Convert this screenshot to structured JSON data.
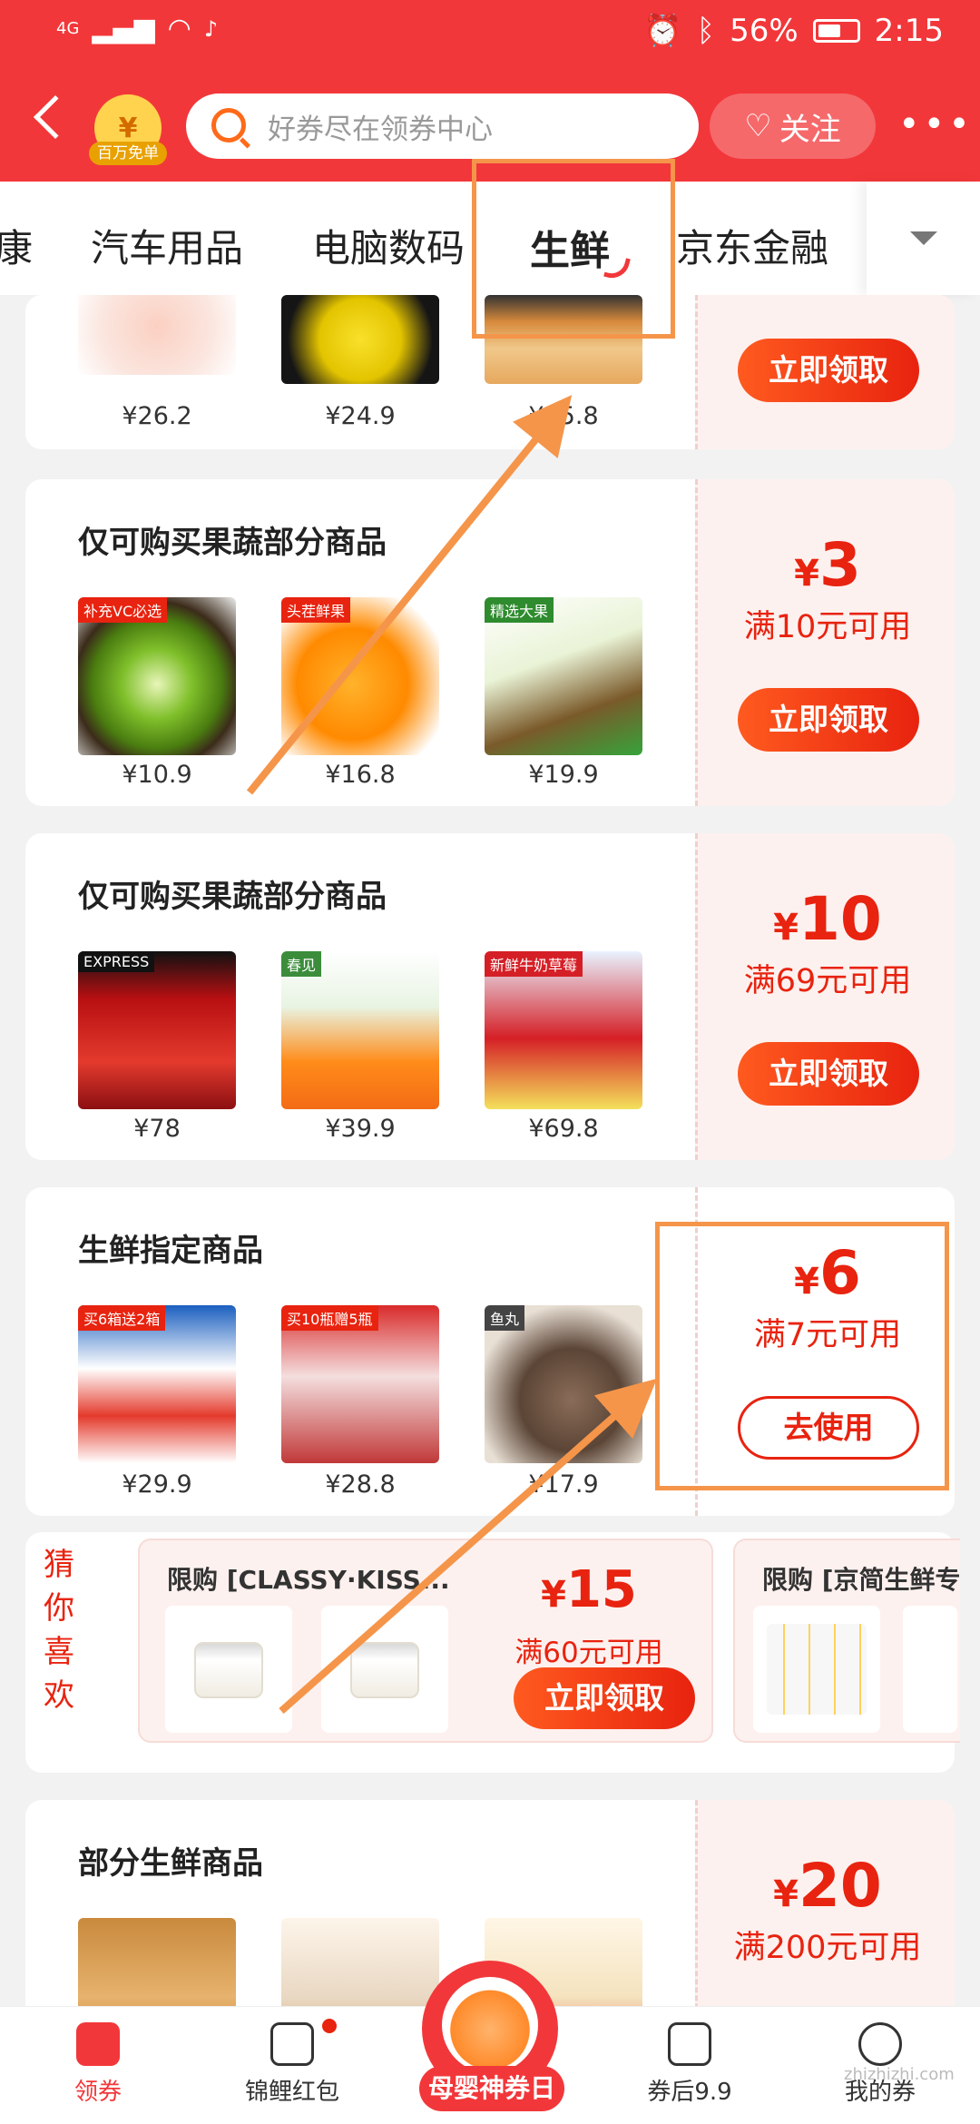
{
  "status_bar": {
    "network": "4G",
    "signal": "ıll",
    "battery": "56%",
    "time": "2:15"
  },
  "header": {
    "badge_symbol": "¥",
    "badge_label": "百万免单",
    "search_placeholder": "好券尽在领券中心",
    "follow_label": "关注",
    "more_label": "•••"
  },
  "tabs": [
    {
      "label": "康"
    },
    {
      "label": "汽车用品"
    },
    {
      "label": "电脑数码"
    },
    {
      "label": "生鲜",
      "active": true
    },
    {
      "label": "京东金融"
    }
  ],
  "cards": [
    {
      "title": "",
      "prices": [
        "¥26.2",
        "¥24.9",
        "¥15.8"
      ],
      "button": "立即领取"
    },
    {
      "title": "仅可购买果蔬部分商品",
      "tags": [
        "补充VC必选",
        "头茬鲜果",
        "精选大果"
      ],
      "prices": [
        "¥10.9",
        "¥16.8",
        "¥19.9"
      ],
      "amount_symbol": "¥",
      "amount": "3",
      "condition": "满10元可用",
      "button": "立即领取"
    },
    {
      "title": "仅可购买果蔬部分商品",
      "tags": [
        "EXPRESS",
        "春见",
        "新鲜牛奶草莓"
      ],
      "prices": [
        "¥78",
        "¥39.9",
        "¥69.8"
      ],
      "amount_symbol": "¥",
      "amount": "10",
      "condition": "满69元可用",
      "button": "立即领取"
    },
    {
      "title": "生鲜指定商品",
      "tags": [
        "买6箱送2箱",
        "买10瓶赠5瓶",
        "鱼丸"
      ],
      "prices": [
        "¥29.9",
        "¥28.8",
        "¥17.9"
      ],
      "amount_symbol": "¥",
      "amount": "6",
      "condition": "满7元可用",
      "button": "去使用"
    },
    {
      "title": "部分生鲜商品",
      "prices": [],
      "amount_symbol": "¥",
      "amount": "20",
      "condition": "满200元可用"
    }
  ],
  "guess": {
    "label": [
      "猜",
      "你",
      "喜",
      "欢"
    ],
    "items": [
      {
        "title": "限购 [CLASSY·KISS...",
        "amount_symbol": "¥",
        "amount": "15",
        "condition": "满60元可用",
        "button": "立即领取"
      },
      {
        "title": "限购 [京简生鲜专"
      }
    ]
  },
  "bottom_nav": [
    {
      "label": "领券",
      "active": true
    },
    {
      "label": "锦鲤红包"
    },
    {
      "label": "母婴神券日"
    },
    {
      "label": "券后9.9"
    },
    {
      "label": "我的券"
    }
  ],
  "watermark": "zhizhizhi.com",
  "colors": {
    "brand_red": "#f2373a",
    "coupon_red": "#e8230f",
    "annotation_orange": "#f5954a"
  }
}
